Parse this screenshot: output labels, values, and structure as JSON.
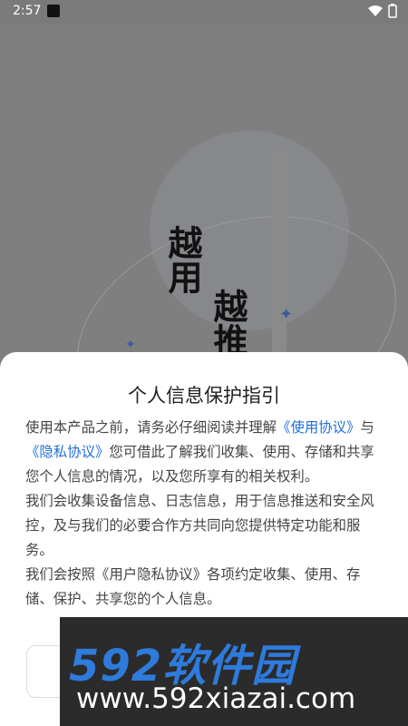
{
  "status_bar": {
    "time": "2:57"
  },
  "background": {
    "vertical_text_1": "越用",
    "vertical_text_2": "越推"
  },
  "dialog": {
    "title": "个人信息保护指引",
    "para1_before": "使用本产品之前，请务必仔细阅读并理解",
    "link_terms": "《使用协议》",
    "para1_mid": "与",
    "link_privacy": "《隐私协议》",
    "para1_after": "您可借此了解我们收集、使用、存储和共享您个人信息的情况，以及您所享有的相关权利。",
    "para2": "我们会收集设备信息、日志信息，用于信息推送和安全风控，及与我们的必要合作方共同向您提供特定功能和服务。",
    "para3": "我们会按照《用户隐私协议》各项约定收集、使用、存储、保护、共享您的个人信息。"
  },
  "watermark": {
    "logo": "592软件园",
    "url": "www.592xiazai.com"
  },
  "colors": {
    "link": "#1e6ed8",
    "dialog_bg": "#ffffff",
    "overlay": "#7f7f7f"
  }
}
